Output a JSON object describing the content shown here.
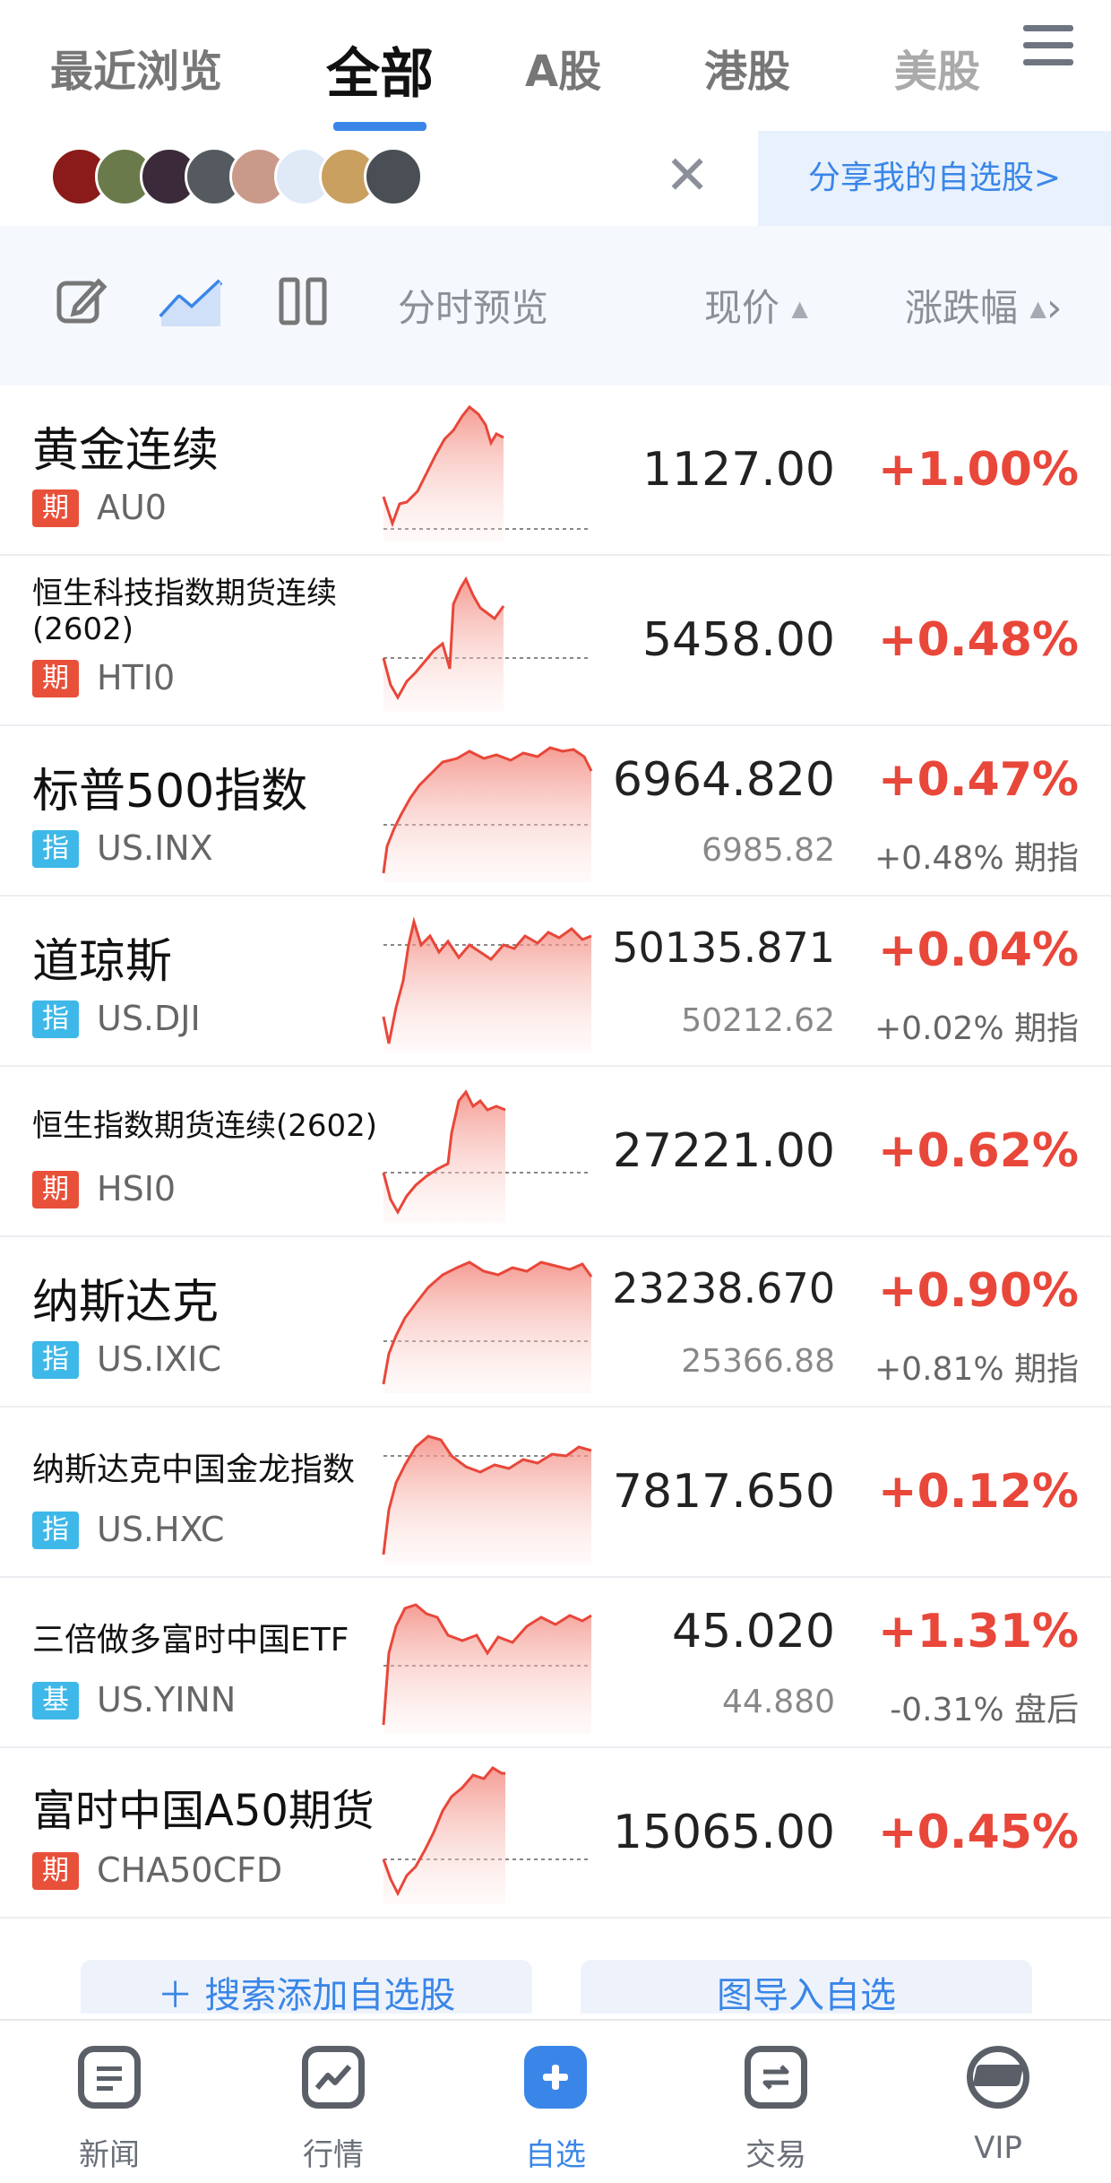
{
  "tabs": [
    "最近浏览",
    "全部",
    "A股",
    "港股",
    "美股"
  ],
  "active_tab": "全部",
  "share": {
    "label": "分享我的自选股>"
  },
  "header": {
    "preview_label": "分时预览",
    "price_label": "现价",
    "change_label": "涨跌幅"
  },
  "rows": [
    {
      "name": "黄金连续",
      "badge": "期",
      "code": "AU0",
      "price": "1127.00",
      "change": "+1.00%"
    },
    {
      "name": "恒生科技指数期货连续(2602)",
      "badge": "期",
      "code": "HTI0",
      "price": "5458.00",
      "change": "+0.48%"
    },
    {
      "name": "标普500指数",
      "badge": "指",
      "code": "US.INX",
      "price": "6964.820",
      "change": "+0.47%",
      "sub_price": "6985.82",
      "sub_change": "+0.48% 期指"
    },
    {
      "name": "道琼斯",
      "badge": "指",
      "code": "US.DJI",
      "price": "50135.871",
      "change": "+0.04%",
      "sub_price": "50212.62",
      "sub_change": "+0.02% 期指"
    },
    {
      "name": "恒生指数期货连续(2602)",
      "badge": "期",
      "code": "HSI0",
      "price": "27221.00",
      "change": "+0.62%"
    },
    {
      "name": "纳斯达克",
      "badge": "指",
      "code": "US.IXIC",
      "price": "23238.670",
      "change": "+0.90%",
      "sub_price": "25366.88",
      "sub_change": "+0.81% 期指"
    },
    {
      "name": "纳斯达克中国金龙指数",
      "badge": "指",
      "code": "US.HXC",
      "price": "7817.650",
      "change": "+0.12%"
    },
    {
      "name": "三倍做多富时中国ETF",
      "badge": "基",
      "code": "US.YINN",
      "price": "45.020",
      "change": "+1.31%",
      "sub_price": "44.880",
      "sub_change": "-0.31% 盘后"
    },
    {
      "name": "富时中国A50期货",
      "badge": "期",
      "code": "CHA50CFD",
      "price": "15065.00",
      "change": "+0.45%"
    }
  ],
  "bottom_buttons": {
    "search": "搜索添加自选股",
    "import": "图导入自选"
  },
  "nav": [
    {
      "label": "新闻",
      "icon": "news-icon"
    },
    {
      "label": "行情",
      "icon": "market-icon"
    },
    {
      "label": "自选",
      "icon": "watchlist-add-icon"
    },
    {
      "label": "交易",
      "icon": "trade-icon"
    },
    {
      "label": "VIP",
      "icon": "vip-icon"
    }
  ],
  "colors": {
    "accent": "#3a86e8",
    "up": "#e8473a",
    "badge_futures": "#e8503a",
    "badge_index": "#3eb8e8"
  }
}
